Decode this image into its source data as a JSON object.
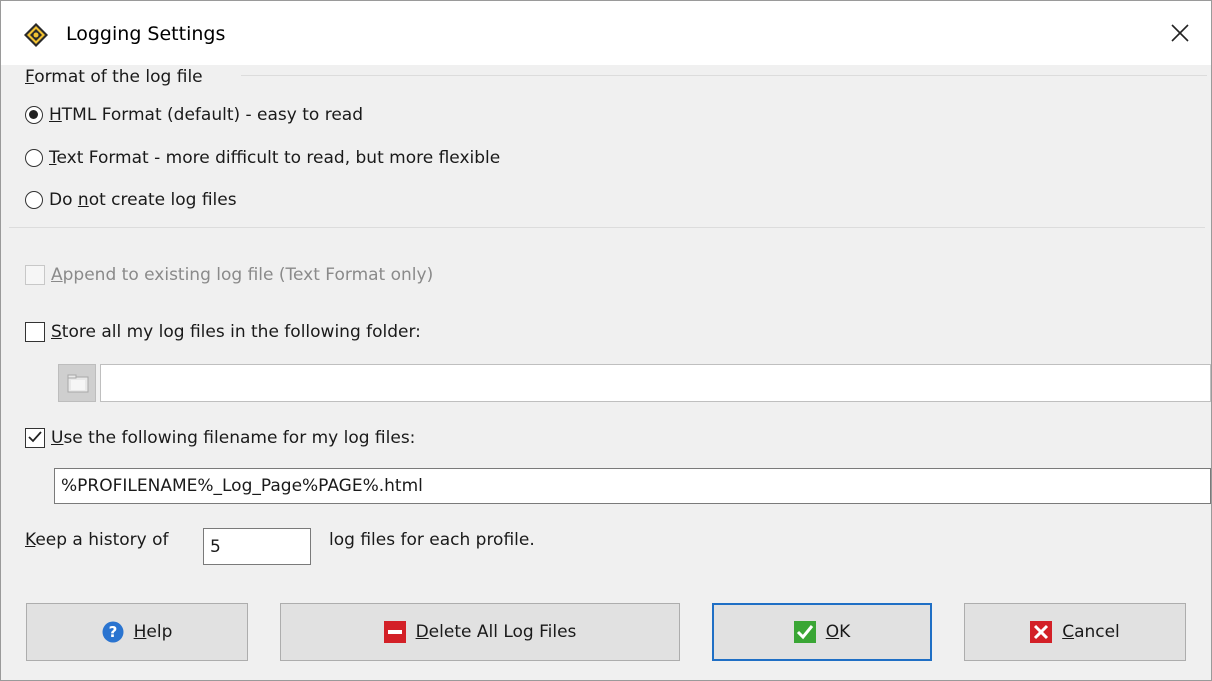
{
  "window": {
    "title": "Logging Settings",
    "icon": "app-diamond-icon"
  },
  "format_group": {
    "label": "Format of the log file",
    "options": [
      {
        "label": "HTML Format (default) - easy to read",
        "accel": "H",
        "checked": true
      },
      {
        "label": "Text Format - more difficult to read, but more flexible",
        "accel": "T",
        "checked": false
      },
      {
        "label": "Do not create log files",
        "accel": "n",
        "checked": false
      }
    ]
  },
  "append": {
    "label": "Append to existing log file (Text Format only)",
    "checked": false,
    "enabled": false
  },
  "store_folder": {
    "label": "Store all my log files in the following folder:",
    "checked": false,
    "value": ""
  },
  "use_filename": {
    "label": "Use the following filename for my log files:",
    "checked": true,
    "value": "%PROFILENAME%_Log_Page%PAGE%.html"
  },
  "history": {
    "prefix": "Keep a history of",
    "value": "5",
    "suffix": "log files for each profile."
  },
  "buttons": {
    "help": "Help",
    "delete": "Delete All Log Files",
    "ok": "OK",
    "cancel": "Cancel"
  },
  "colors": {
    "accent": "#1f6fc5",
    "help_icon": "#2a74d0",
    "delete_icon": "#d32027",
    "ok_icon": "#3aa635",
    "cancel_icon": "#d32027"
  }
}
